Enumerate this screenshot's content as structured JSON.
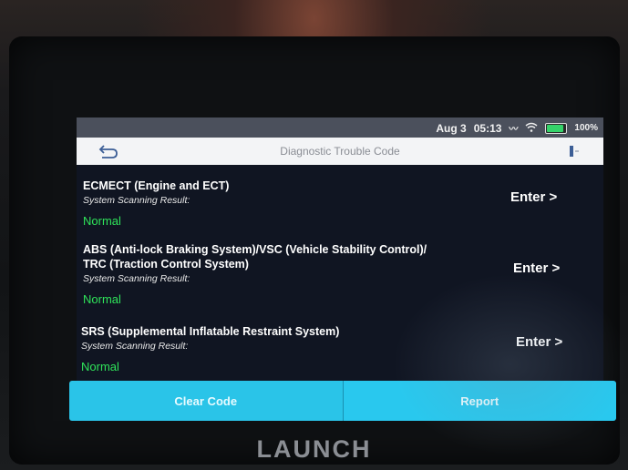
{
  "status_bar": {
    "date": "Aug 3",
    "time": "05:13",
    "battery": "100%",
    "battery_level": 1.0
  },
  "header": {
    "title": "Diagnostic Trouble Code"
  },
  "systems": [
    {
      "name_lines": [
        "ECMECT (Engine and ECT)"
      ],
      "label": "System Scanning Result:",
      "result": "Normal",
      "enter": "Enter >"
    },
    {
      "name_lines": [
        "ABS (Anti-lock Braking System)/VSC (Vehicle Stability Control)/",
        "TRC (Traction Control System)"
      ],
      "label": "System Scanning Result:",
      "result": "Normal",
      "enter": "Enter >"
    },
    {
      "name_lines": [
        "SRS (Supplemental Inflatable Restraint System)"
      ],
      "label": "System Scanning Result:",
      "result": "Normal",
      "enter": "Enter >"
    }
  ],
  "actions": {
    "clear_code": "Clear Code",
    "report": "Report"
  },
  "brand": "LAUNCH",
  "colors": {
    "status_bar_bg": "#4b505c",
    "screen_bg": "#101522",
    "result_green": "#2fe35a",
    "button_cyan": "#2ac4e8",
    "battery_green": "#35d36a"
  },
  "icons": {
    "back": "back-arrow-icon",
    "exit": "exit-door-icon",
    "signal": "signal-icon",
    "wifi": "wifi-icon",
    "battery": "battery-icon"
  }
}
